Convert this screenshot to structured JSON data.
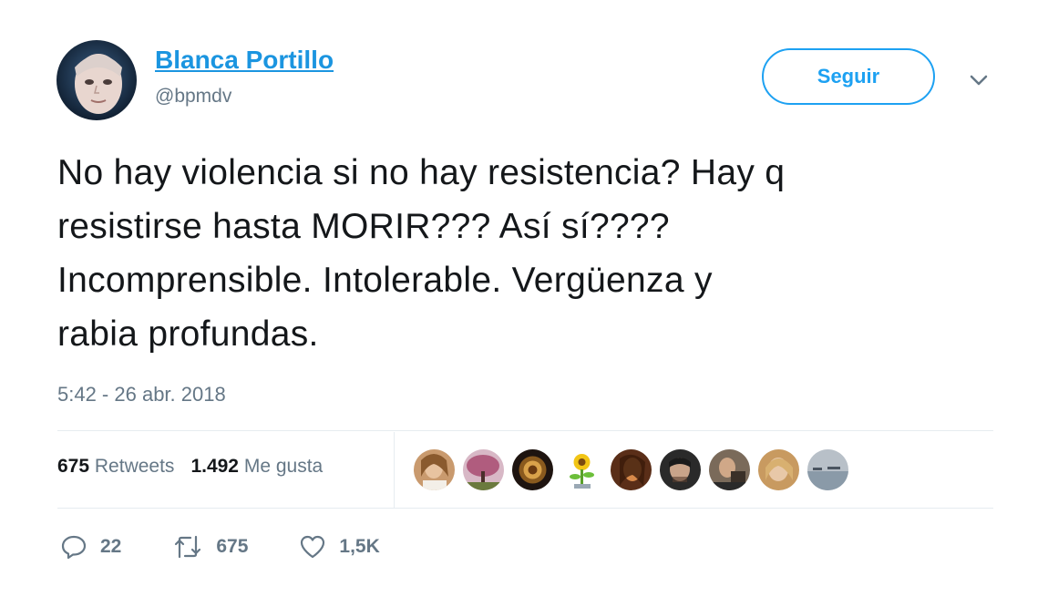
{
  "user": {
    "name": "Blanca Portillo",
    "handle": "@bpmdv"
  },
  "follow_button": {
    "label": "Seguir"
  },
  "tweet": {
    "text": "No hay violencia si no hay resistencia? Hay q\nresistirse hasta MORIR??? Así sí????\nIncomprensible. Intolerable. Vergüenza y\nrabia profundas.",
    "timestamp": "5:42 - 26 abr. 2018"
  },
  "stats": {
    "retweets_count": "675",
    "retweets_label": "Retweets",
    "likes_count": "1.492",
    "likes_label": "Me gusta"
  },
  "actions": {
    "reply_count": "22",
    "retweet_count": "675",
    "like_count": "1,5K"
  },
  "icons": {
    "caret": "chevron-down-icon",
    "reply": "reply-icon",
    "retweet": "retweet-icon",
    "like": "heart-icon"
  },
  "colors": {
    "accent": "#1da1f2",
    "link": "#1b95e0",
    "muted": "#657786",
    "text": "#14171a",
    "divider": "#e6ecf0"
  }
}
